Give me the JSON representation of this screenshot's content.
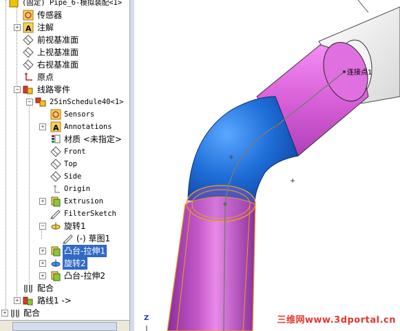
{
  "tree": {
    "top_row": "(固定) Pipe_6-模拟装配<1>",
    "sensors_cn": "传感器",
    "annotations_cn": "注解",
    "front_plane_cn": "前视基准面",
    "top_plane_cn": "上视基准面",
    "right_plane_cn": "右视基准面",
    "origin_cn": "原点",
    "route_parts": "线路零件",
    "pipe_part": "25inSchedule40<1>",
    "sensors": "Sensors",
    "annotations": "Annotations",
    "material": "材质 <未指定>",
    "front": "Front",
    "top": "Top",
    "side": "Side",
    "origin": "Origin",
    "extrusion": "Extrusion",
    "filter_sketch": "FilterSketch",
    "revolve1": "旋转1",
    "sketch1": "(-) 草图1",
    "boss_extrude1": "凸台-拉伸1",
    "revolve2": "旋转2",
    "boss_extrude2": "凸台-拉伸2",
    "mates_inner": "配合",
    "route1": "路线1 ->",
    "mates_outer": "配合"
  },
  "viewport": {
    "point_label": "连接点1",
    "axis_z": "Z"
  },
  "watermark": "三维网www.3dportal.cn",
  "colors": {
    "selection": "#316ac5",
    "pipe_pink": "#e070e0",
    "pipe_purple": "#9a3fa8",
    "elbow_blue": "#2a7de8",
    "edge_orange": "#f0a020"
  }
}
